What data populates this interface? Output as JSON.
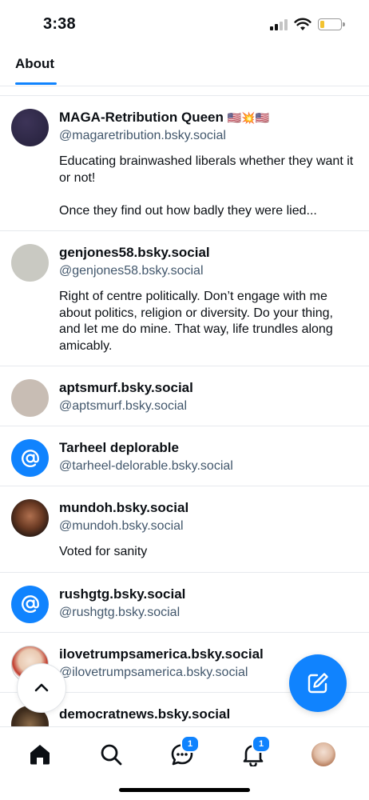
{
  "status_bar": {
    "time": "3:38"
  },
  "tabs": [
    {
      "label": "About"
    }
  ],
  "users": [
    {
      "name": "MAGA-Retribution Queen",
      "name_suffix": "🇺🇸💥🇺🇸",
      "handle": "@magaretribution.bsky.social",
      "bio": "Educating brainwashed liberals whether they want it or not!\n\nOnce they find out how badly they were lied...",
      "avatar": "dark-avatar"
    },
    {
      "name": "genjones58.bsky.social",
      "handle": "@genjones58.bsky.social",
      "bio": "Right of centre politically. Don’t engage with me about politics, religion or diversity. Do your thing, and let me do mine. That way, life trundles along amicably.",
      "avatar": "gray-avatar"
    },
    {
      "name": "aptsmurf.bsky.social",
      "handle": "@aptsmurf.bsky.social",
      "bio": "",
      "avatar": "gray-avatar"
    },
    {
      "name": "Tarheel deplorable",
      "handle": "@tarheel-delorable.bsky.social",
      "bio": "",
      "avatar": "at-icon"
    },
    {
      "name": "mundoh.bsky.social",
      "handle": "@mundoh.bsky.social",
      "bio": "Voted for sanity",
      "avatar": "photo-avatar"
    },
    {
      "name": "rushgtg.bsky.social",
      "handle": "@rushgtg.bsky.social",
      "bio": "",
      "avatar": "at-icon"
    },
    {
      "name": "ilovetrumpsamerica.bsky.social",
      "handle": "@ilovetrumpsamerica.bsky.social",
      "bio": "",
      "avatar": "photo-avatar"
    },
    {
      "name": "democratnews.bsky.social",
      "handle": "",
      "bio": "",
      "avatar": "photo-avatar"
    }
  ],
  "nav": {
    "items": [
      "home-icon",
      "search-icon",
      "chat-icon",
      "bell-icon",
      "profile-avatar"
    ],
    "chat_badge": "1",
    "notifications_badge": "1"
  },
  "colors": {
    "accent": "#1083fe",
    "text": "#0b0f14",
    "secondary_text": "#42576c",
    "divider": "#e6e9ed"
  }
}
